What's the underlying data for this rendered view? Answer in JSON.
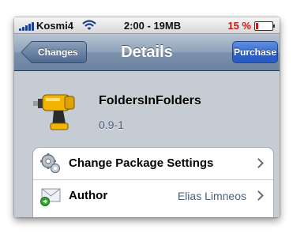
{
  "status_bar": {
    "carrier": "Kosmi4",
    "time": "2:00 - 19MB",
    "battery_percent": "15 %",
    "battery_level": 0.15,
    "battery_color": "#c81818"
  },
  "nav": {
    "back_label": "Changes",
    "title": "Details",
    "action_label": "Purchase"
  },
  "package": {
    "icon": "drill-icon",
    "name": "FoldersInFolders",
    "version": "0.9-1"
  },
  "rows": [
    {
      "icon": "gears-icon",
      "label": "Change Package Settings",
      "value": ""
    },
    {
      "icon": "mail-icon",
      "label": "Author",
      "value": "Elias Limneos"
    }
  ],
  "colors": {
    "nav_bar": "#7b91ab",
    "purchase_button": "#3c6fd4",
    "background": "#c5ccd4",
    "detail_text": "#4a5d7a"
  }
}
